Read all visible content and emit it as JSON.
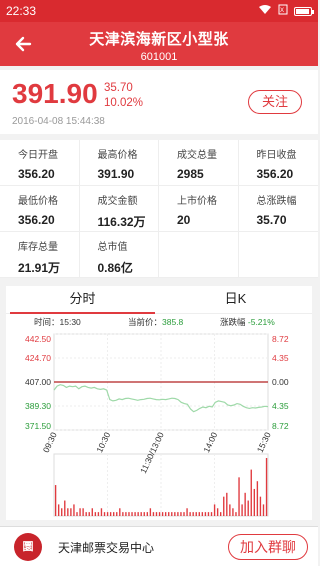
{
  "status_bar": {
    "time": "22:33"
  },
  "header": {
    "title": "天津滨海新区小型张",
    "code": "601001"
  },
  "quote": {
    "price": "391.90",
    "change": "35.70",
    "change_pct": "10.02%",
    "timestamp": "2016-04-08 15:44:38",
    "follow_label": "关注"
  },
  "stats": [
    {
      "label": "今日开盘",
      "value": "356.20"
    },
    {
      "label": "最高价格",
      "value": "391.90"
    },
    {
      "label": "成交总量",
      "value": "2985"
    },
    {
      "label": "昨日收盘",
      "value": "356.20"
    },
    {
      "label": "最低价格",
      "value": "356.20"
    },
    {
      "label": "成交金额",
      "value": "116.32万"
    },
    {
      "label": "上市价格",
      "value": "20"
    },
    {
      "label": "总涨跌幅",
      "value": "35.70"
    },
    {
      "label": "库存总量",
      "value": "21.91万"
    },
    {
      "label": "总市值",
      "value": "0.86亿"
    }
  ],
  "tabs": {
    "intraday": "分时",
    "kline": "日K"
  },
  "chart_info": {
    "time": "时间：15:30",
    "current_price": "当前价：",
    "current_price_value": "385.8",
    "change_pct": "涨跌幅",
    "change_pct_value": "-5.21%"
  },
  "chart_data": {
    "type": "line",
    "y_left_ticks": [
      "442.50",
      "424.70",
      "407.00",
      "389.30",
      "371.50"
    ],
    "y_right_ticks": [
      "8.72",
      "4.35",
      "0.00",
      "4.35",
      "8.72"
    ],
    "x_ticks": [
      "09:30",
      "10:30",
      "11:30/13:00",
      "14:00",
      "15:30"
    ],
    "ylim": [
      371.5,
      442.5
    ],
    "reference_price": 407.0,
    "colors": {
      "price_line": "#9ed9a8",
      "reference_line": "#b22222",
      "up_tick": "#e03a3f",
      "down_tick": "#2a9d3a",
      "volume": "#e03a3f"
    },
    "series": [
      {
        "values": [
          401,
          404,
          405,
          404.5,
          403,
          404,
          403.5,
          404,
          402,
          403.5,
          404,
          403,
          402.5,
          403,
          402,
          401.5,
          402,
          401,
          394,
          393,
          393.5,
          394.5,
          394,
          394.8,
          395,
          394.5,
          394,
          393.5,
          394,
          394.2,
          394.8,
          395,
          394.5,
          394,
          393.8,
          394.2,
          394,
          394.5,
          395,
          394.8,
          394,
          392,
          391,
          390.5,
          387,
          385,
          386,
          387.5,
          388.5,
          388,
          389,
          388.5,
          392,
          393,
          392.5,
          392,
          390,
          389.5,
          390,
          391,
          390.5,
          389,
          388,
          387.5,
          388,
          387.8,
          388.2,
          388.5,
          389,
          388.8
        ]
      }
    ],
    "volume": [
      8,
      3,
      2,
      4,
      2,
      2,
      3,
      1,
      2,
      2,
      1,
      1,
      2,
      1,
      1,
      2,
      1,
      1,
      1,
      1,
      1,
      2,
      1,
      1,
      1,
      1,
      1,
      1,
      1,
      1,
      1,
      2,
      1,
      1,
      1,
      1,
      1,
      1,
      1,
      1,
      1,
      1,
      1,
      2,
      1,
      1,
      1,
      1,
      1,
      1,
      1,
      1,
      3,
      2,
      1,
      5,
      6,
      3,
      2,
      1,
      10,
      3,
      6,
      4,
      12,
      7,
      9,
      5,
      3,
      15
    ],
    "volume_max": 15
  },
  "bottom_bar": {
    "logo_text": "圜",
    "org_name": "天津邮票交易中心",
    "join_label": "加入群聊"
  }
}
